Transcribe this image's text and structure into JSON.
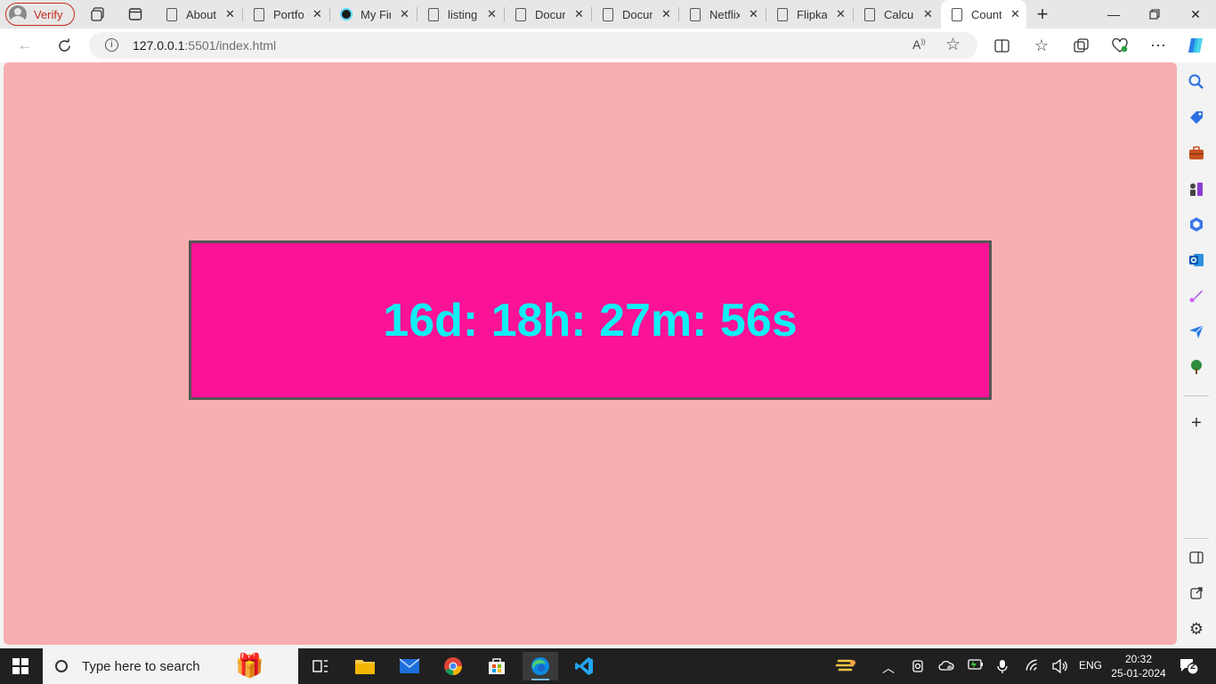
{
  "browser": {
    "profile_label": "Verify",
    "tabs": [
      {
        "label": "About"
      },
      {
        "label": "Portfolio"
      },
      {
        "label": "My First"
      },
      {
        "label": "listing"
      },
      {
        "label": "Document"
      },
      {
        "label": "Document"
      },
      {
        "label": "Netflix"
      },
      {
        "label": "Flipkart"
      },
      {
        "label": "Calculator"
      },
      {
        "label": "Count"
      }
    ],
    "active_tab_index": 9,
    "address": {
      "host": "127.0.0.1",
      "rest": ":5501/index.html"
    }
  },
  "page": {
    "countdown": "16d: 18h: 27m: 56s",
    "colors": {
      "background": "#f7afaf",
      "box": "#fc1296",
      "text": "#0ff0f4",
      "border": "#555555"
    }
  },
  "taskbar": {
    "search_placeholder": "Type here to search",
    "language": "ENG",
    "time": "20:32",
    "date": "25-01-2024",
    "notification_count": "2"
  }
}
